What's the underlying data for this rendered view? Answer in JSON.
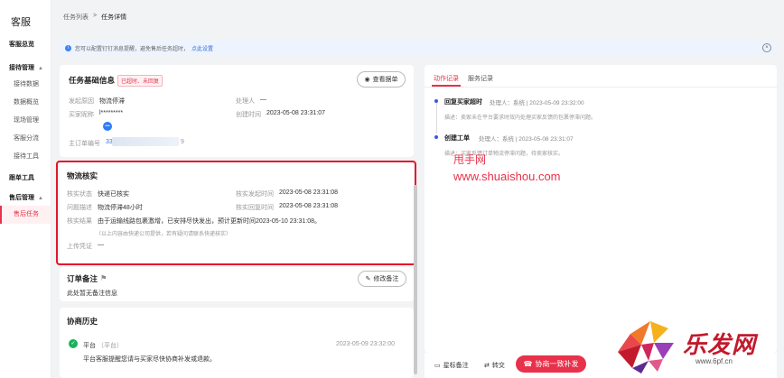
{
  "sidebar": {
    "brand": "客服",
    "overview": "客服总览",
    "reception_group": "接待管理",
    "reception_items": [
      "接待数据",
      "数据概览",
      "现场管理",
      "客服分流",
      "接待工具"
    ],
    "work_order": "跟单工具",
    "aftersale_group": "售后管理",
    "aftersale_items": [
      "售后任务"
    ]
  },
  "breadcrumb": {
    "parent": "任务列表",
    "sep": ">",
    "current": "任务详情"
  },
  "notice": {
    "text": "您可以配置钉钉消息提醒，避免售后任务超时，",
    "link": "点此设置",
    "close": "×"
  },
  "basic": {
    "title": "任务基础信息",
    "tag": "已超时、未回复",
    "view_btn": "查看据单",
    "fields": {
      "reason_label": "发起原因",
      "reason_value": "物流停滞",
      "handler_label": "处理人",
      "handler_value": "—",
      "buyer_label": "买家昵称",
      "buyer_value": "l*********",
      "created_label": "创建时间",
      "created_value": "2023-05-08 23:31:07",
      "order_label": "主订单编号",
      "order_prefix": "33",
      "order_suffix": "9"
    }
  },
  "logistics": {
    "title": "物流核实",
    "status_label": "核实状态",
    "status_value": "快递已核实",
    "start_label": "核实发起时间",
    "start_value": "2023-05-08 23:31:08",
    "issue_label": "问题描述",
    "issue_value": "物流停滞48小时",
    "reply_label": "核实回复时间",
    "reply_value": "2023-05-08 23:31:08",
    "result_label": "核实结果",
    "result_value": "由于运输线路包裹激增，已安排尽快发出，预计更新时间2023-05-10 23:31:08。",
    "result_note": "（以上内容由快递公司提供，若有疑问请联系快递核实）",
    "proof_label": "上传凭证",
    "proof_value": "—"
  },
  "remark": {
    "title": "订单备注",
    "edit_btn": "修改备注",
    "empty": "此处暂无备注信息"
  },
  "history": {
    "title": "协商历史",
    "author": "平台",
    "author_role": "（平台）",
    "time": "2023-05-09 23:32:00",
    "text": "平台客服提醒您请与买家尽快协商补发或退款。"
  },
  "right_panel": {
    "tabs": [
      "动作记录",
      "服务记录"
    ],
    "records": [
      {
        "title": "回复买家超时",
        "meta": "处理人：系统 | 2023-05-09 23:32:00",
        "desc": "描述：卖家未在平台要求时效内处理买家反馈的包裹停滞问题。"
      },
      {
        "title": "创建工单",
        "meta": "处理人：系统 | 2023-05-08 23:31:07",
        "desc": "描述：买家反馈订单物流停滞问题，待卖家核实。"
      }
    ]
  },
  "bottom_actions": {
    "star": "星标备注",
    "transfer": "转交",
    "primary": "协商一致补发"
  },
  "watermark": {
    "cn": "甩手网",
    "url": "www.shuaishou.com",
    "logo": "乐发网",
    "logo_url": "www.6pf.cn"
  },
  "colors": {
    "accent": "#e8314a",
    "frame": "#e1172c",
    "timeline": "#3a5ad9"
  }
}
